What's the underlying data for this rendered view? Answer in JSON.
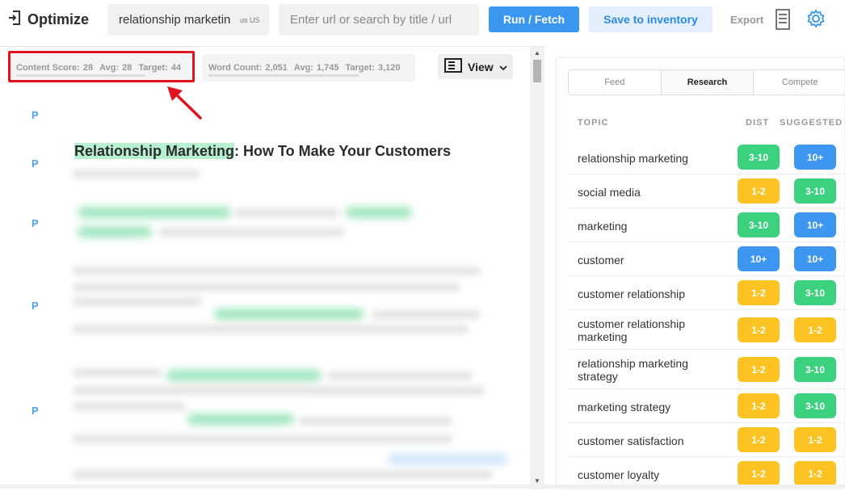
{
  "brand": {
    "title": "Optimize"
  },
  "search": {
    "keyword": "relationship marketing",
    "locale": "us US",
    "url_placeholder": "Enter url or search by title / url"
  },
  "toolbar": {
    "run_label": "Run / Fetch",
    "save_label": "Save to inventory",
    "export_label": "Export"
  },
  "scores": {
    "content": {
      "label": "Content Score:",
      "value": "28",
      "avg_label": "Avg:",
      "avg": "28",
      "target_label": "Target:",
      "target": "44"
    },
    "words": {
      "label": "Word Count:",
      "value": "2,051",
      "avg_label": "Avg:",
      "avg": "1,745",
      "target_label": "Target:",
      "target": "3,120"
    }
  },
  "view": {
    "label": "View"
  },
  "editor": {
    "paragraph_marker": "P",
    "title_highlight": "Relationship Marketing",
    "title_rest": ": How To Make Your Customers"
  },
  "panel": {
    "tabs": [
      {
        "label": "Feed",
        "active": false
      },
      {
        "label": "Research",
        "active": true
      },
      {
        "label": "Compete",
        "active": false
      }
    ],
    "headers": {
      "topic": "TOPIC",
      "dist": "DIST",
      "suggested": "SUGGESTED"
    },
    "topics": [
      {
        "name": "relationship marketing",
        "dist": "3-10",
        "dist_color": "green",
        "suggested": "10+",
        "suggested_color": "blue"
      },
      {
        "name": "social media",
        "dist": "1-2",
        "dist_color": "yellow",
        "suggested": "3-10",
        "suggested_color": "green"
      },
      {
        "name": "marketing",
        "dist": "3-10",
        "dist_color": "green",
        "suggested": "10+",
        "suggested_color": "blue"
      },
      {
        "name": "customer",
        "dist": "10+",
        "dist_color": "blue",
        "suggested": "10+",
        "suggested_color": "blue"
      },
      {
        "name": "customer relationship",
        "dist": "1-2",
        "dist_color": "yellow",
        "suggested": "3-10",
        "suggested_color": "green"
      },
      {
        "name": "customer relationship marketing",
        "dist": "1-2",
        "dist_color": "yellow",
        "suggested": "1-2",
        "suggested_color": "yellow"
      },
      {
        "name": "relationship marketing strategy",
        "dist": "1-2",
        "dist_color": "yellow",
        "suggested": "3-10",
        "suggested_color": "green"
      },
      {
        "name": "marketing strategy",
        "dist": "1-2",
        "dist_color": "yellow",
        "suggested": "3-10",
        "suggested_color": "green"
      },
      {
        "name": "customer satisfaction",
        "dist": "1-2",
        "dist_color": "yellow",
        "suggested": "1-2",
        "suggested_color": "yellow"
      },
      {
        "name": "customer loyalty",
        "dist": "1-2",
        "dist_color": "yellow",
        "suggested": "1-2",
        "suggested_color": "yellow"
      }
    ]
  },
  "colors": {
    "accent": "#3a97f0",
    "green": "#3bd17e",
    "yellow": "#fdc322",
    "blue": "#3d97f0",
    "highlight_box": "#e0141e"
  }
}
